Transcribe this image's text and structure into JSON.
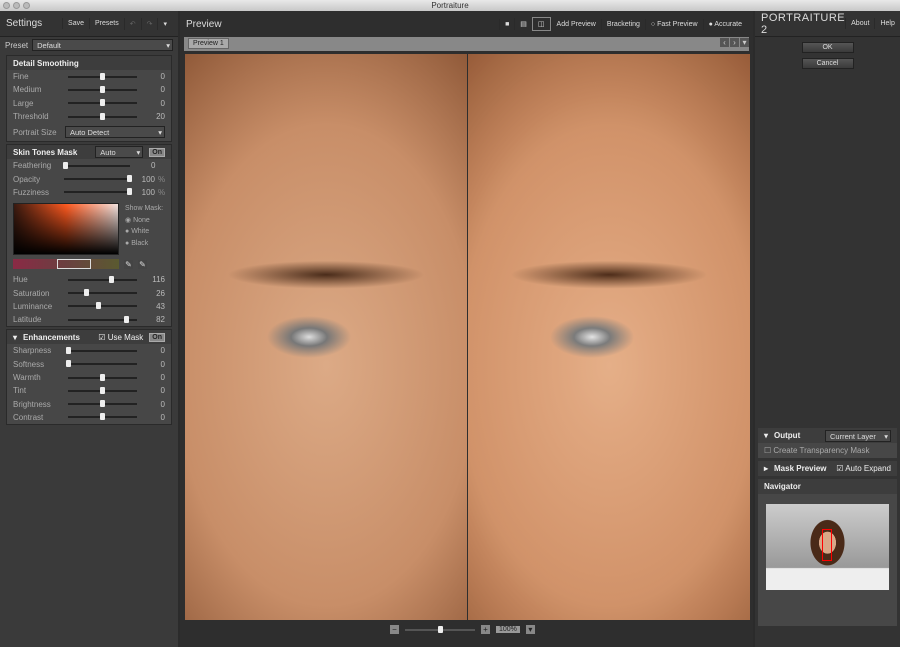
{
  "window": {
    "title": "Portraiture"
  },
  "settings": {
    "title": "Settings",
    "save": "Save",
    "presets": "Presets",
    "preset_label": "Preset",
    "preset_value": "Default"
  },
  "detail": {
    "title": "Detail Smoothing",
    "sliders": [
      {
        "label": "Fine",
        "value": "0",
        "position": 0.5
      },
      {
        "label": "Medium",
        "value": "0",
        "position": 0.5
      },
      {
        "label": "Large",
        "value": "0",
        "position": 0.5
      },
      {
        "label": "Threshold",
        "value": "20",
        "position": 0.5
      }
    ],
    "portrait_size_label": "Portrait Size",
    "portrait_size_value": "Auto Detect"
  },
  "skin": {
    "title": "Skin Tones Mask",
    "mode": "Auto",
    "on": "On",
    "sliders": [
      {
        "label": "Feathering",
        "value": "0",
        "unit": "",
        "position": 0.0
      },
      {
        "label": "Opacity",
        "value": "100",
        "unit": "%",
        "position": 1.0
      },
      {
        "label": "Fuzziness",
        "value": "100",
        "unit": "%",
        "position": 1.0
      }
    ],
    "show_mask_label": "Show Mask:",
    "mask_options": [
      {
        "label": "None",
        "selected": true
      },
      {
        "label": "White",
        "selected": false
      },
      {
        "label": "Black",
        "selected": false
      }
    ],
    "sliders2": [
      {
        "label": "Hue",
        "value": "116",
        "position": 0.62
      },
      {
        "label": "Saturation",
        "value": "26",
        "position": 0.26
      },
      {
        "label": "Luminance",
        "value": "43",
        "position": 0.44
      },
      {
        "label": "Latitude",
        "value": "82",
        "position": 0.84
      }
    ]
  },
  "enh": {
    "title": "Enhancements",
    "use_mask": "Use Mask",
    "on": "On",
    "sliders": [
      {
        "label": "Sharpness",
        "value": "0",
        "position": 0.0
      },
      {
        "label": "Softness",
        "value": "0",
        "position": 0.0
      },
      {
        "label": "Warmth",
        "value": "0",
        "position": 0.5
      },
      {
        "label": "Tint",
        "value": "0",
        "position": 0.5
      },
      {
        "label": "Brightness",
        "value": "0",
        "position": 0.5
      },
      {
        "label": "Contrast",
        "value": "0",
        "position": 0.5
      }
    ]
  },
  "preview": {
    "title": "Preview",
    "add_preview": "Add Preview",
    "bracketing": "Bracketing",
    "fast": "Fast Preview",
    "accurate": "Accurate",
    "tab": "Preview 1",
    "zoom": "100%",
    "zoom_position": 0.5
  },
  "right": {
    "logo": "PORTRAITURE 2",
    "about": "About",
    "help": "Help",
    "ok": "OK",
    "cancel": "Cancel",
    "output": "Output",
    "output_value": "Current Layer",
    "transparency": "Create Transparency Mask",
    "mask_preview": "Mask Preview",
    "auto_expand": "Auto Expand",
    "navigator": "Navigator"
  }
}
